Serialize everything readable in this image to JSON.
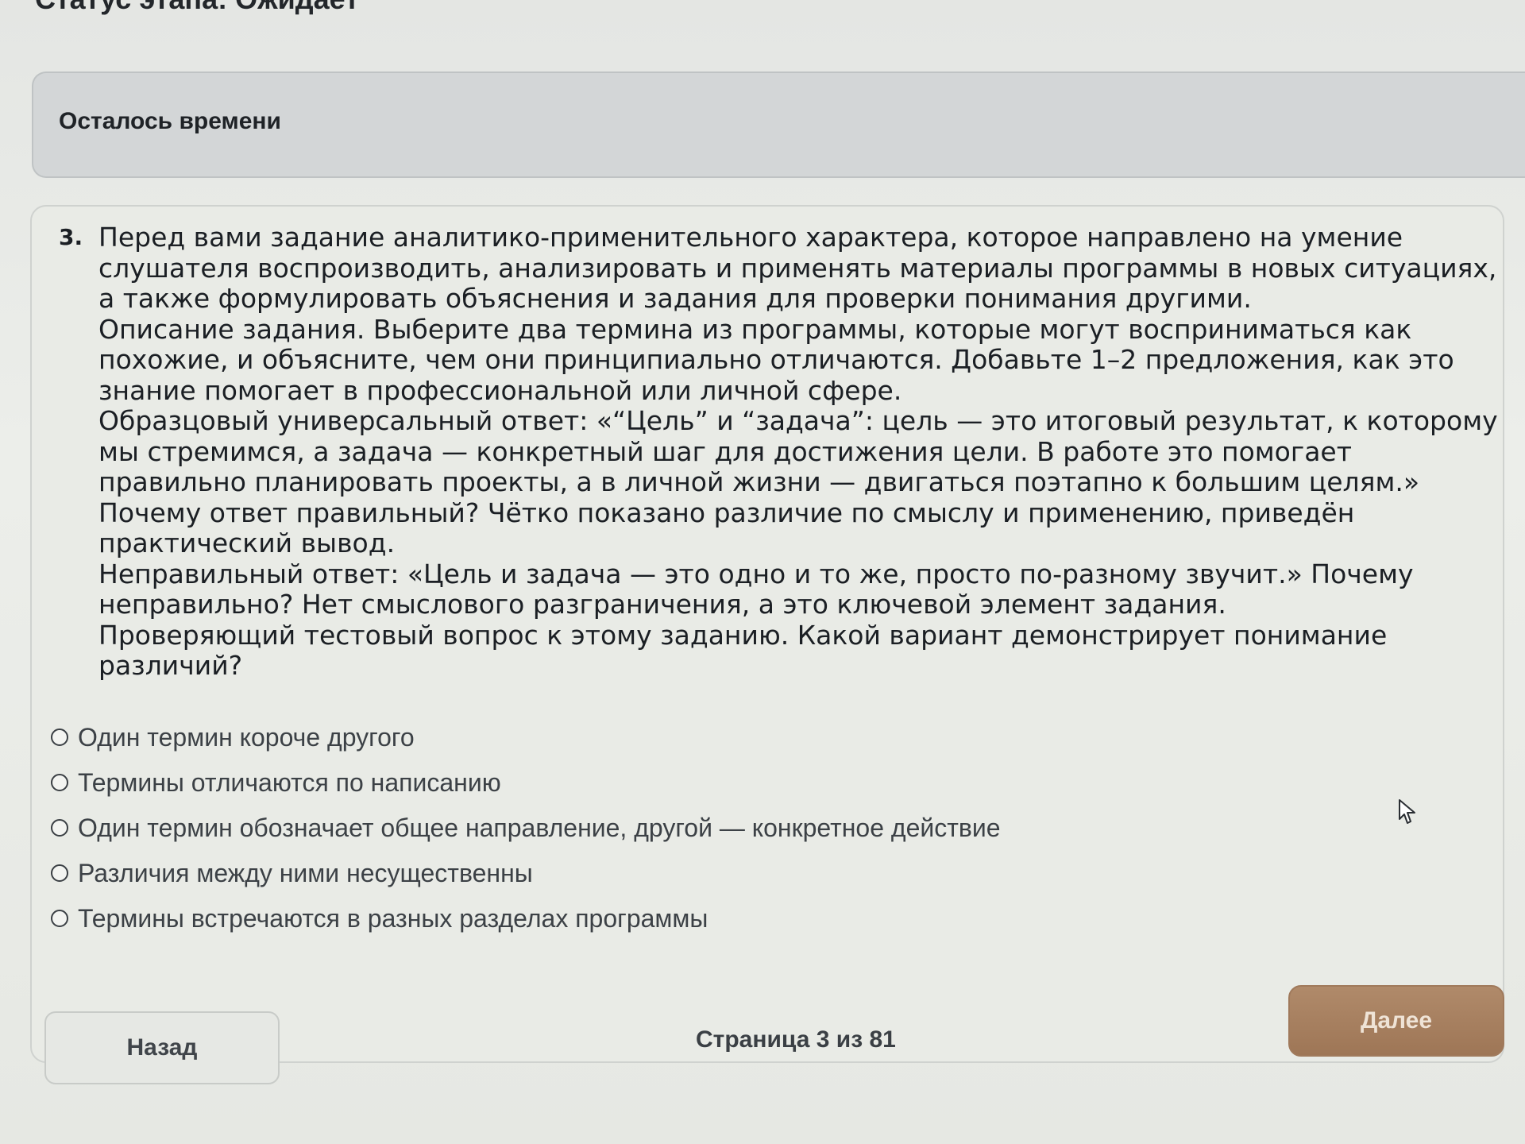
{
  "header": {
    "stage_status": "Статус этапа: Ожидает"
  },
  "timer": {
    "label": "Осталось времени"
  },
  "question": {
    "number": "3.",
    "paragraphs": [
      "Перед вами задание аналитико-применительного характера, которое направлено на умение слушателя воспроизводить, анализировать и применять материалы программы в новых ситуациях, а также формулировать объяснения и задания для проверки понимания другими.",
      "Описание задания. Выберите два термина из программы, которые могут восприниматься как похожие, и объясните, чем они принципиально отличаются. Добавьте 1–2 предложения, как это знание помогает в профессиональной или личной сфере.",
      "Образцовый универсальный ответ: «“Цель” и “задача”: цель — это итоговый результат, к которому мы стремимся, а задача — конкретный шаг для достижения цели. В работе это помогает правильно планировать проекты, а в личной жизни — двигаться поэтапно к большим целям.» Почему ответ правильный? Чётко показано различие по смыслу и применению, приведён практический вывод.",
      "Неправильный ответ: «Цель и задача — это одно и то же, просто по-разному звучит.» Почему неправильно? Нет смыслового разграничения, а это ключевой элемент задания.",
      "Проверяющий тестовый вопрос к этому заданию. Какой вариант демонстрирует понимание различий?"
    ],
    "options": [
      "Один термин короче другого",
      "Термины отличаются по написанию",
      "Один термин обозначает общее направление, другой — конкретное действие",
      "Различия между ними несущественны",
      "Термины встречаются в разных разделах программы"
    ]
  },
  "footer": {
    "back_label": "Назад",
    "page_indicator": "Страница 3 из 81",
    "next_label": "Далее"
  },
  "colors": {
    "next_button": "#a57c5c",
    "timer_bar": "#d3d6d7",
    "background": "#e9ebe6"
  },
  "icons": {
    "cursor": "mouse-pointer-icon"
  }
}
